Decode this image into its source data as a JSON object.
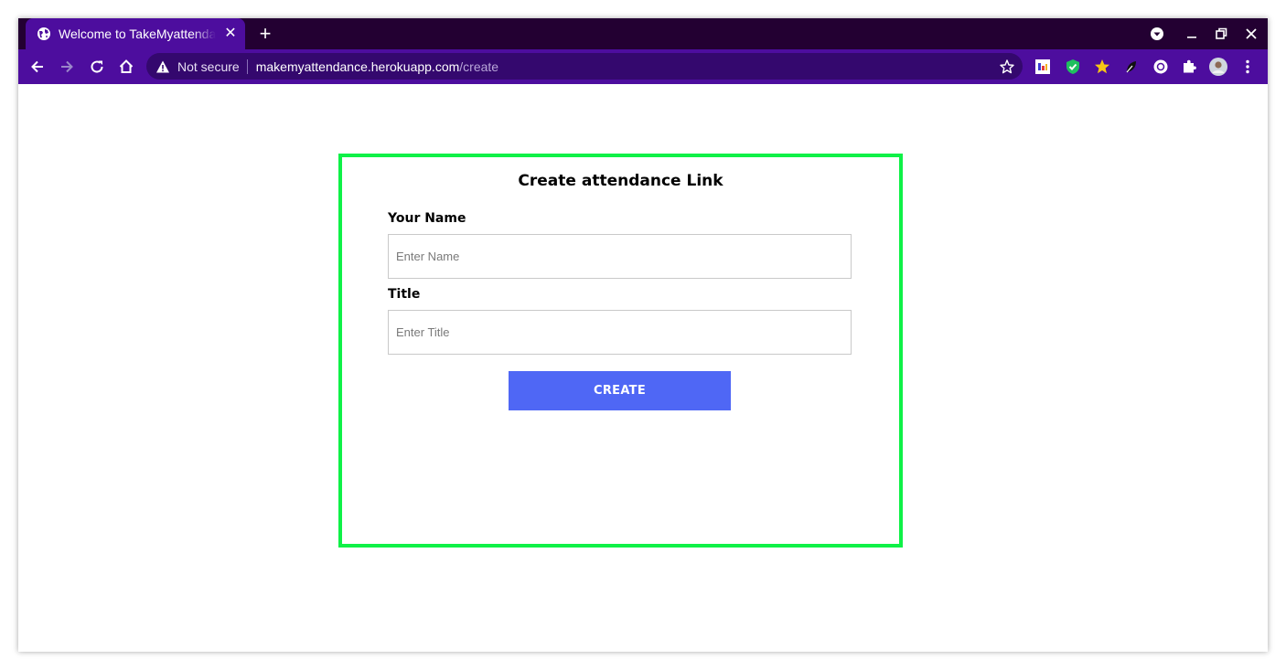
{
  "browser": {
    "tab": {
      "title": "Welcome to TakeMyattendance",
      "icon": "globe-icon",
      "close_icon": "close-icon"
    },
    "new_tab_icon": "plus-icon",
    "window_controls": [
      "minimize-icon",
      "restore-icon",
      "close-icon"
    ],
    "nav": [
      "back-icon",
      "forward-icon",
      "reload-icon",
      "home-icon"
    ],
    "omnibox": {
      "security_label": "Not secure",
      "url_host": "makemyattendance.herokuapp.com",
      "url_path": "/create"
    },
    "extensions": [
      "ext-grid-icon",
      "ext-shield-icon",
      "ext-star-icon",
      "ext-leaf-icon",
      "ext-circle-icon",
      "puzzle-icon",
      "profile-avatar",
      "menu-dots-icon"
    ],
    "colors": {
      "tabstrip": "#230032",
      "toolbar": "#4d0d9e",
      "omnibox": "#34086e"
    }
  },
  "form": {
    "title": "Create attendance Link",
    "name_label": "Your Name",
    "name_placeholder": "Enter Name",
    "title_label": "Title",
    "title_placeholder": "Enter Title",
    "submit_label": "CREATE",
    "colors": {
      "border": "#0ff147",
      "button": "#4f67f5"
    }
  }
}
